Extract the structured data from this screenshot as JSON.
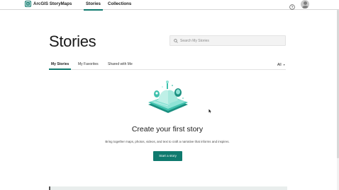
{
  "header": {
    "brand": "ArcGIS StoryMaps",
    "brand_icon": "storymaps-logo-icon",
    "tabs": [
      {
        "label": "Stories",
        "active": true
      },
      {
        "label": "Collections",
        "active": false
      }
    ],
    "help_icon": "question-circle-icon",
    "avatar_icon": "user-avatar-icon"
  },
  "page": {
    "title": "Stories",
    "search_placeholder": "Search My Stories",
    "search_value": ""
  },
  "subtabs": [
    {
      "label": "My Stories",
      "active": true
    },
    {
      "label": "My Favorites",
      "active": false
    },
    {
      "label": "Shared with Me",
      "active": false
    }
  ],
  "filter": {
    "selected": "All",
    "icon": "chevron-down-icon"
  },
  "empty_state": {
    "illustration": "book-with-map-pins-illustration",
    "title": "Create your first story",
    "description": "Bring together maps, photos, videos, and text to craft a narrative that informs and inspires.",
    "button_label": "Start a story"
  },
  "colors": {
    "accent": "#0f7a6e",
    "illustration_light": "#8fe3d6",
    "illustration_mid": "#3fc1ad",
    "illustration_dark": "#1b8f80"
  }
}
